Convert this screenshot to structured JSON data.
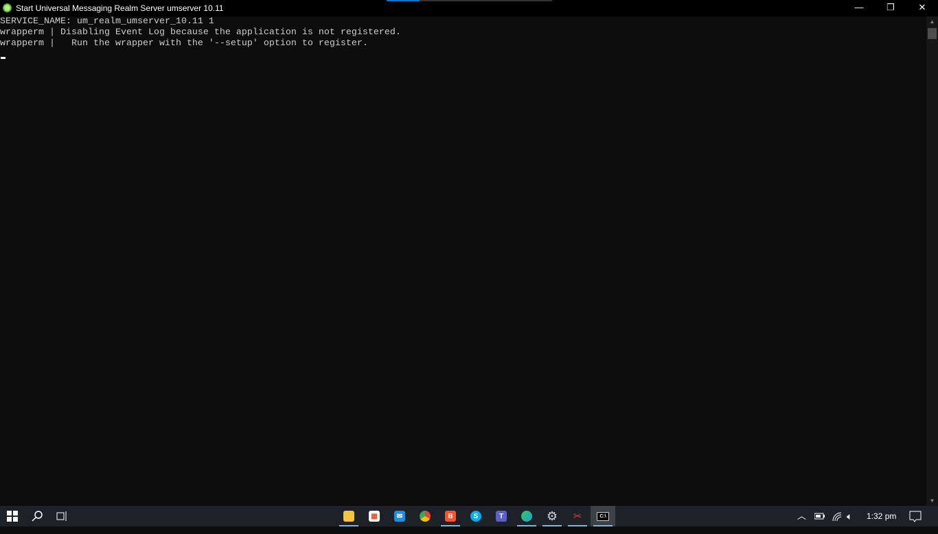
{
  "window": {
    "title": "Start Universal Messaging Realm Server umserver 10.11",
    "minimize": "—",
    "restore": "❐",
    "close": "✕"
  },
  "console": {
    "lines": [
      "SERVICE_NAME: um_realm_umserver_10.11 1",
      "wrapperm | Disabling Event Log because the application is not registered.",
      "wrapperm |   Run the wrapper with the '--setup' option to register."
    ]
  },
  "taskbar": {
    "apps": [
      {
        "name": "File Explorer",
        "icon": "folder-icon",
        "color": "#f4c542"
      },
      {
        "name": "Microsoft Store",
        "icon": "store-icon",
        "color": "#ffffff"
      },
      {
        "name": "Mail",
        "icon": "mail-icon",
        "color": "#1e8fe0"
      },
      {
        "name": "Chrome",
        "icon": "chrome-icon",
        "color": "#34a853"
      },
      {
        "name": "Brave",
        "icon": "brave-icon",
        "color": "#fb542b"
      },
      {
        "name": "Skype",
        "icon": "skype-icon",
        "color": "#00aff0"
      },
      {
        "name": "Teams",
        "icon": "teams-icon",
        "color": "#5b5fc7"
      },
      {
        "name": "Edge",
        "icon": "edge-icon",
        "color": "#1fa0d8"
      },
      {
        "name": "Settings",
        "icon": "gear-icon",
        "color": "#cfd8dc"
      },
      {
        "name": "Snipping Tool",
        "icon": "scissors-icon",
        "color": "#e03c31"
      },
      {
        "name": "Command Prompt",
        "icon": "cmd-icon",
        "color": "#000000"
      }
    ],
    "time": "1:32 pm"
  }
}
